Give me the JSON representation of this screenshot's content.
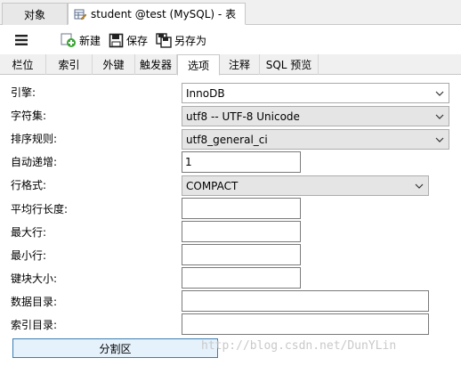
{
  "window_tabs": {
    "objects": "对象",
    "active": "student @test (MySQL) - 表"
  },
  "toolbar": {
    "new": "新建",
    "save": "保存",
    "save_as": "另存为"
  },
  "tabs": [
    "栏位",
    "索引",
    "外键",
    "触发器",
    "选项",
    "注释",
    "SQL 预览"
  ],
  "selected_tab": "选项",
  "form": {
    "engine_label": "引擎:",
    "engine_value": "InnoDB",
    "charset_label": "字符集:",
    "charset_value": "utf8 -- UTF-8 Unicode",
    "collation_label": "排序规则:",
    "collation_value": "utf8_general_ci",
    "auto_inc_label": "自动递增:",
    "auto_inc_value": "1",
    "row_format_label": "行格式:",
    "row_format_value": "COMPACT",
    "avg_row_len_label": "平均行长度:",
    "avg_row_len_value": "",
    "max_rows_label": "最大行:",
    "max_rows_value": "",
    "min_rows_label": "最小行:",
    "min_rows_value": "",
    "key_block_label": "键块大小:",
    "key_block_value": "",
    "data_dir_label": "数据目录:",
    "data_dir_value": "",
    "index_dir_label": "索引目录:",
    "index_dir_value": ""
  },
  "partition_button": "分割区",
  "watermark": "http://blog.csdn.net/DunYLin",
  "colors": {
    "accent_border": "#3c7fb1",
    "button_fill": "#e5f1fb",
    "new_icon_green": "#3aa535"
  }
}
